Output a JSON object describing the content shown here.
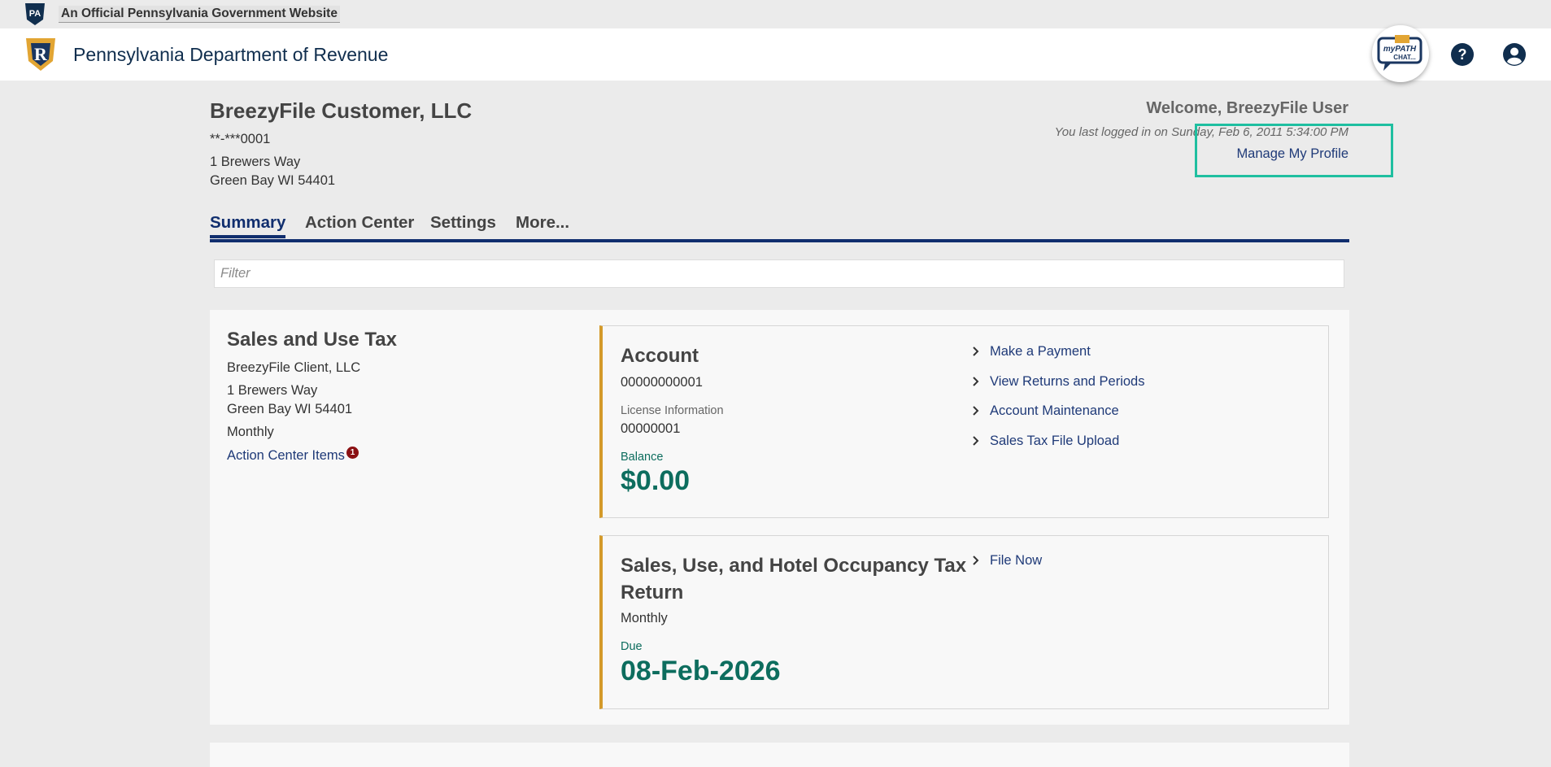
{
  "gov_banner": {
    "badge_text": "PA",
    "text": "An Official Pennsylvania Government Website"
  },
  "header": {
    "logo_letter": "R",
    "site_title": "Pennsylvania Department of Revenue",
    "chat_text_top": "myPATH",
    "chat_text_bottom": "CHAT...",
    "help_icon": "question-circle-icon",
    "account_icon": "user-circle-icon"
  },
  "customer": {
    "name": "BreezyFile Customer, LLC",
    "id": "**-***0001",
    "address_line1": "1 Brewers Way",
    "address_line2": "Green Bay WI 54401"
  },
  "welcome": {
    "greeting": "Welcome, BreezyFile User",
    "last_login": "You last logged in on Sunday, Feb 6, 2011 5:34:00 PM",
    "manage_profile": "Manage My Profile"
  },
  "tabs": [
    {
      "label": "Summary",
      "active": true
    },
    {
      "label": "Action Center",
      "active": false
    },
    {
      "label": "Settings",
      "active": false
    },
    {
      "label": "More...",
      "active": false
    }
  ],
  "filter": {
    "placeholder": "Filter",
    "value": ""
  },
  "tax_account": {
    "title": "Sales and Use Tax",
    "client_name": "BreezyFile Client, LLC",
    "address_line1": "1 Brewers Way",
    "address_line2": "Green Bay WI 54401",
    "frequency": "Monthly",
    "action_center_items": "Action Center Items",
    "action_center_count": "1",
    "account": {
      "title": "Account",
      "number": "00000000001",
      "license_label": "License Information",
      "license_number": "00000001",
      "balance_label": "Balance",
      "balance": "$0.00",
      "actions": [
        "Make a Payment",
        "View Returns and Periods",
        "Account Maintenance",
        "Sales Tax File Upload"
      ]
    },
    "return": {
      "title_line1": "Sales, Use, and Hotel Occupancy Tax",
      "title_line2": "Return",
      "frequency": "Monthly",
      "due_label": "Due",
      "due_date": "08-Feb-2026",
      "actions": [
        "File Now"
      ]
    }
  },
  "colors": {
    "navy": "#102e6e",
    "link": "#1f3a78",
    "green": "#0d6d5e",
    "accent_gold": "#d49a2a",
    "highlight": "#1fbfa0",
    "badge_red": "#8b1113"
  }
}
